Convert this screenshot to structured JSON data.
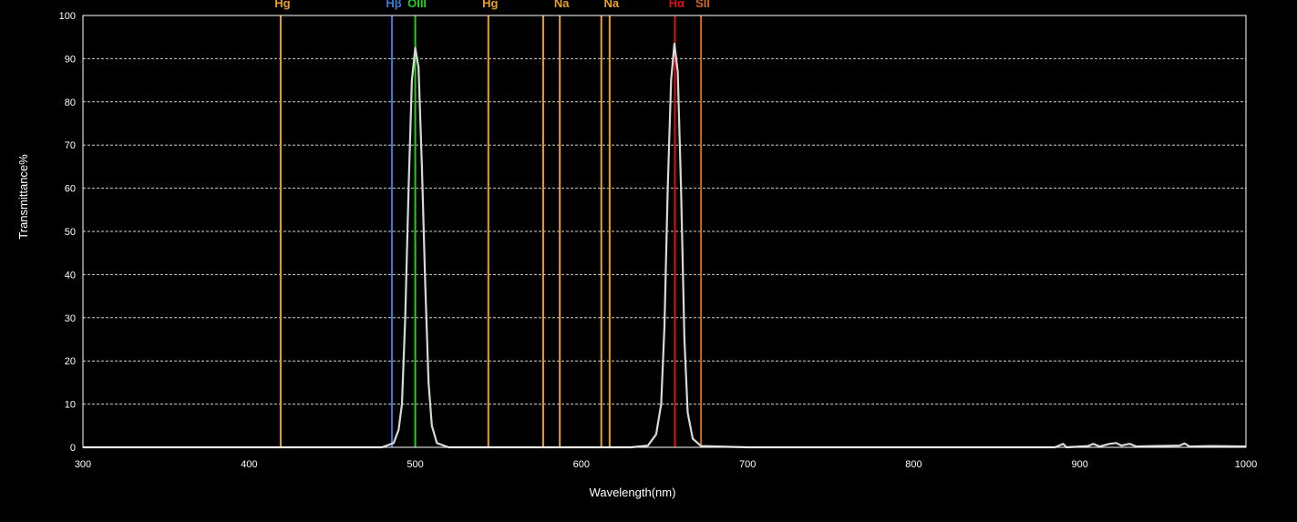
{
  "chart_data": {
    "type": "line",
    "title": "",
    "xlabel": "Wavelength(nm)",
    "ylabel": "Transmittance%",
    "xlim": [
      300,
      1000
    ],
    "ylim": [
      0,
      100
    ],
    "x_ticks": [
      300,
      400,
      500,
      600,
      700,
      800,
      900,
      1000
    ],
    "y_ticks": [
      0,
      10,
      20,
      30,
      40,
      50,
      60,
      70,
      80,
      90,
      100
    ],
    "grid": "horizontal-dashed",
    "background": "#000000",
    "plot_border_color": "#ffffff",
    "series": [
      {
        "color": "#d8d8d8",
        "points": [
          [
            300,
            0
          ],
          [
            480,
            0
          ],
          [
            487,
            1
          ],
          [
            490,
            4
          ],
          [
            492,
            10
          ],
          [
            494,
            30
          ],
          [
            496,
            60
          ],
          [
            498,
            85
          ],
          [
            500,
            92.5
          ],
          [
            502,
            88
          ],
          [
            504,
            65
          ],
          [
            506,
            38
          ],
          [
            508,
            15
          ],
          [
            510,
            5
          ],
          [
            513,
            1
          ],
          [
            520,
            0
          ],
          [
            630,
            0
          ],
          [
            640,
            0.4
          ],
          [
            645,
            3
          ],
          [
            648,
            10
          ],
          [
            650,
            28
          ],
          [
            652,
            60
          ],
          [
            654,
            85
          ],
          [
            656,
            93.5
          ],
          [
            658,
            87
          ],
          [
            660,
            60
          ],
          [
            662,
            25
          ],
          [
            664,
            8
          ],
          [
            667,
            2
          ],
          [
            672,
            0.3
          ],
          [
            700,
            0
          ],
          [
            885,
            0
          ],
          [
            890,
            0.8
          ],
          [
            892,
            0
          ],
          [
            905,
            0.3
          ],
          [
            908,
            0.8
          ],
          [
            912,
            0.2
          ],
          [
            918,
            0.8
          ],
          [
            922,
            1.0
          ],
          [
            925,
            0.4
          ],
          [
            930,
            0.8
          ],
          [
            934,
            0.2
          ],
          [
            945,
            0.3
          ],
          [
            960,
            0.4
          ],
          [
            963,
            0.9
          ],
          [
            966,
            0.2
          ],
          [
            980,
            0.3
          ],
          [
            1000,
            0.2
          ]
        ]
      }
    ],
    "emission_lines": [
      {
        "label": "Hg",
        "wavelength": 419,
        "color": "#e8a020"
      },
      {
        "label": "Hβ",
        "wavelength": 486,
        "color": "#3a7ad8"
      },
      {
        "label": "OIII",
        "wavelength": 500,
        "color": "#22cc22"
      },
      {
        "label": "Hg",
        "wavelength": 544,
        "color": "#e8a020"
      },
      {
        "label": "",
        "wavelength": 577,
        "color": "#e8a020"
      },
      {
        "label": "Na",
        "wavelength": 587,
        "color": "#e8a020"
      },
      {
        "label": "",
        "wavelength": 612,
        "color": "#e8a020"
      },
      {
        "label": "Na",
        "wavelength": 617,
        "color": "#e8a020"
      },
      {
        "label": "Hα",
        "wavelength": 656.3,
        "color": "#e01010"
      },
      {
        "label": "SII",
        "wavelength": 672,
        "color": "#d06820"
      }
    ]
  }
}
